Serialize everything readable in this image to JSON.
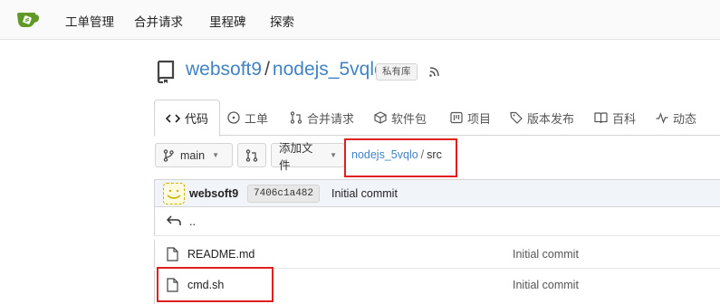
{
  "nav": {
    "items": [
      "工单管理",
      "合并请求",
      "里程碑",
      "探索"
    ]
  },
  "repo": {
    "owner": "websoft9",
    "separator": "/",
    "name": "nodejs_5vqlo",
    "private_badge": "私有库"
  },
  "tabs": [
    {
      "label": "代码",
      "icon": "code-icon"
    },
    {
      "label": "工单",
      "icon": "issue-icon"
    },
    {
      "label": "合并请求",
      "icon": "pull-request-icon"
    },
    {
      "label": "软件包",
      "icon": "package-icon"
    },
    {
      "label": "项目",
      "icon": "project-icon"
    },
    {
      "label": "版本发布",
      "icon": "tag-icon"
    },
    {
      "label": "百科",
      "icon": "book-icon"
    },
    {
      "label": "动态",
      "icon": "pulse-icon"
    }
  ],
  "toolbar": {
    "branch": "main",
    "add_file": "添加文件"
  },
  "breadcrumb": {
    "repo": "nodejs_5vqlo",
    "separator": "/",
    "dir": "src"
  },
  "commit": {
    "user": "websoft9",
    "sha": "7406c1a482",
    "message": "Initial commit"
  },
  "files": {
    "parent": "..",
    "rows": [
      {
        "name": "README.md",
        "message": "Initial commit"
      },
      {
        "name": "cmd.sh",
        "message": "Initial commit"
      }
    ]
  },
  "colors": {
    "link": "#4183c4",
    "highlight": "#e02020",
    "logo": "#609926"
  }
}
